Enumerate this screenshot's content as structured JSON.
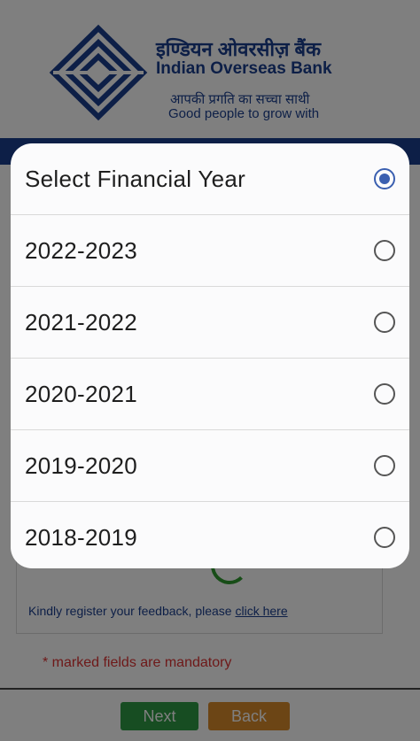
{
  "header": {
    "brand_hindi": "इण्डियन ओवरसीज़ बैंक",
    "brand_english": "Indian Overseas Bank",
    "tagline_hindi": "आपकी प्रगति का सच्चा साथी",
    "tagline_english": "Good people to grow with"
  },
  "form": {
    "feedback_text": "Kindly register your feedback, please",
    "feedback_link": "click here",
    "mandatory_note": "* marked fields are mandatory"
  },
  "buttons": {
    "next": "Next",
    "back": "Back"
  },
  "dialog": {
    "options": [
      {
        "label": "Select Financial Year",
        "selected": true
      },
      {
        "label": "2022-2023",
        "selected": false
      },
      {
        "label": "2021-2022",
        "selected": false
      },
      {
        "label": "2020-2021",
        "selected": false
      },
      {
        "label": "2019-2020",
        "selected": false
      },
      {
        "label": "2018-2019",
        "selected": false
      }
    ]
  },
  "colors": {
    "brand_blue": "#1b3f8f",
    "radio_selected": "#3a5fb0",
    "next_button": "#2f9a44",
    "back_button": "#d88a2b",
    "mandatory_text": "#dd3333"
  }
}
